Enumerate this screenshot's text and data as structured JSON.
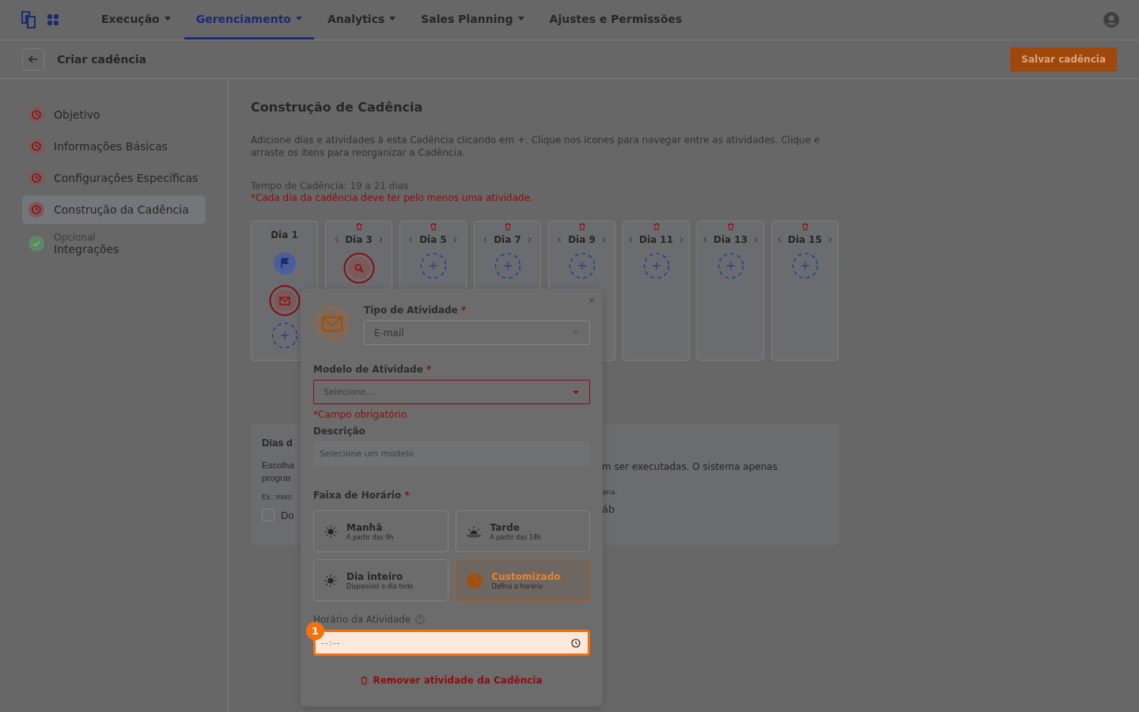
{
  "nav": {
    "items": [
      {
        "label": "Execução",
        "selected": false,
        "dropdown": true
      },
      {
        "label": "Gerenciamento",
        "selected": true,
        "dropdown": true
      },
      {
        "label": "Analytics",
        "selected": false,
        "dropdown": true
      },
      {
        "label": "Sales Planning",
        "selected": false,
        "dropdown": true
      },
      {
        "label": "Ajustes e Permissões",
        "selected": false,
        "dropdown": false
      }
    ]
  },
  "header": {
    "title": "Criar cadência",
    "save_button": "Salvar cadência"
  },
  "steps": [
    {
      "label": "Objetivo",
      "complete": false,
      "selected": false
    },
    {
      "label": "Informações Básicas",
      "complete": false,
      "selected": false
    },
    {
      "label": "Configurações Específicas",
      "complete": false,
      "selected": false
    },
    {
      "label": "Construção da Cadência",
      "complete": false,
      "selected": true
    },
    {
      "label": "Integrações",
      "note": "Opcional",
      "complete": true,
      "selected": false
    }
  ],
  "builder": {
    "title": "Construção de Cadência",
    "description": "Adicione dias e atividades à esta Cadência clicando em +. Clique nos ícones para navegar entre as atividades. Clique e arraste os itens para reorganizar a Cadência.",
    "duration": "Tempo de Cadência: 19 a 21 dias",
    "warning": "*Cada dia da cadência deve ter pelo menos uma atividade.",
    "days": [
      {
        "label": "Dia 1",
        "removable": false,
        "activities": [
          {
            "kind": "flag",
            "error": false
          },
          {
            "kind": "email",
            "error": true
          }
        ]
      },
      {
        "label": "Dia 3",
        "removable": true,
        "add_hidden": true,
        "activities": [
          {
            "kind": "search",
            "error": true
          }
        ]
      },
      {
        "label": "Dia 5",
        "removable": true
      },
      {
        "label": "Dia 7",
        "removable": true
      },
      {
        "label": "Dia 9",
        "removable": true
      },
      {
        "label": "Dia 11",
        "removable": true
      },
      {
        "label": "Dia 13",
        "removable": true
      },
      {
        "label": "Dia 15",
        "removable": true
      }
    ]
  },
  "week_days": {
    "title": "Dias d",
    "text_left": [
      "Escolha",
      "prograr"
    ],
    "text_right": "m ser executadas. O sistema apenas",
    "example_left": "Ex.: marc",
    "example_right": "ana.",
    "checkbox_left": {
      "label": "Do",
      "checked": false
    },
    "label_right": "áb"
  },
  "popover": {
    "type_label": "Tipo de Atividade",
    "type_required": "*",
    "type_value": "E-mail",
    "model_label": "Modelo de Atividade",
    "model_required": "*",
    "model_placeholder": "Selecione...",
    "model_error": "*Campo obrigatório.",
    "description_label": "Descrição",
    "description_placeholder": "Selecione um modelo",
    "slots_label": "Faixa de Horário",
    "slots_required": "*",
    "slots": [
      {
        "kind": "sun",
        "label": "Manhã",
        "sub": "A partir das 9h",
        "selected": false
      },
      {
        "kind": "sunrise",
        "label": "Tarde",
        "sub": "A partir das 14h",
        "selected": false
      },
      {
        "kind": "sun",
        "label": "Dia inteiro",
        "sub": "Disponível o dia todo",
        "selected": false
      },
      {
        "kind": "clock",
        "label": "Customizado",
        "sub": "Defina o horário",
        "selected": true
      }
    ],
    "time_label": "Horário da Atividade",
    "time_placeholder": "--:--",
    "step_badge": "1",
    "remove_button": "Remover atividade da Cadência"
  }
}
